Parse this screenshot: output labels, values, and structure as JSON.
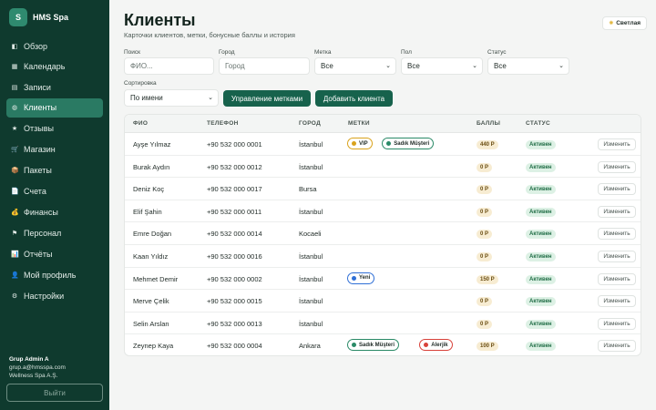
{
  "brand": {
    "logo_letter": "S",
    "name": "HMS Spa"
  },
  "sidebar": {
    "items": [
      {
        "label": "Обзор",
        "icon": "dashboard-icon",
        "glyph": "◧",
        "active": false
      },
      {
        "label": "Календарь",
        "icon": "calendar-icon",
        "glyph": "▦",
        "active": false
      },
      {
        "label": "Записи",
        "icon": "appointments-icon",
        "glyph": "▤",
        "active": false
      },
      {
        "label": "Клиенты",
        "icon": "clients-icon",
        "glyph": "◍",
        "active": true
      },
      {
        "label": "Отзывы",
        "icon": "star-icon",
        "glyph": "★",
        "active": false
      },
      {
        "label": "Магазин",
        "icon": "cart-icon",
        "glyph": "🛒",
        "active": false
      },
      {
        "label": "Пакеты",
        "icon": "package-icon",
        "glyph": "📦",
        "active": false
      },
      {
        "label": "Счета",
        "icon": "invoice-icon",
        "glyph": "📄",
        "active": false
      },
      {
        "label": "Финансы",
        "icon": "money-bag-icon",
        "glyph": "💰",
        "active": false
      },
      {
        "label": "Персонал",
        "icon": "flag-icon",
        "glyph": "⚑",
        "active": false
      },
      {
        "label": "Отчёты",
        "icon": "reports-icon",
        "glyph": "📊",
        "active": false
      },
      {
        "label": "Мой профиль",
        "icon": "profile-icon",
        "glyph": "👤",
        "active": false
      },
      {
        "label": "Настройки",
        "icon": "gear-icon",
        "glyph": "⚙",
        "active": false
      }
    ]
  },
  "user": {
    "name": "Grup Admin A",
    "email": "grup.a@hmsspa.com",
    "company": "Wellness Spa A.Ş.",
    "logout_label": "Выйти"
  },
  "header": {
    "title": "Клиенты",
    "subtitle": "Карточки клиентов, метки, бонусные баллы и история",
    "theme_label": "Светлая",
    "theme_icon": "sun-icon"
  },
  "filters": {
    "search_label": "Поиск",
    "search_placeholder": "ФИО...",
    "city_label": "Город",
    "city_placeholder": "Город",
    "tag_label": "Метка",
    "tag_value": "Все",
    "gender_label": "Пол",
    "gender_value": "Все",
    "status_label": "Статус",
    "status_value": "Все",
    "sort_label": "Сортировка",
    "sort_value": "По имени"
  },
  "actions": {
    "manage_tags": "Управление метками",
    "add_client": "Добавить клиента"
  },
  "table": {
    "columns": [
      "ФИО",
      "ТЕЛЕФОН",
      "ГОРОД",
      "МЕТКИ",
      "БАЛЛЫ",
      "СТАТУС"
    ],
    "edit_label": "Изменить",
    "tag_colors": {
      "VIP": "#d9a21b",
      "Sadık Müşteri": "#2a8a67",
      "Yeni": "#2f6fd6",
      "Alerjik": "#d8423a"
    },
    "rows": [
      {
        "name": "Ayşe Yılmaz",
        "phone": "+90 532 000 0001",
        "city": "İstanbul",
        "tags": [
          "VIP",
          "Sadık Müşteri"
        ],
        "points": "440 P",
        "status": "Активен"
      },
      {
        "name": "Burak Aydın",
        "phone": "+90 532 000 0012",
        "city": "İstanbul",
        "tags": [],
        "points": "0 P",
        "status": "Активен"
      },
      {
        "name": "Deniz Koç",
        "phone": "+90 532 000 0017",
        "city": "Bursa",
        "tags": [],
        "points": "0 P",
        "status": "Активен"
      },
      {
        "name": "Elif Şahin",
        "phone": "+90 532 000 0011",
        "city": "İstanbul",
        "tags": [],
        "points": "0 P",
        "status": "Активен"
      },
      {
        "name": "Emre Doğan",
        "phone": "+90 532 000 0014",
        "city": "Kocaeli",
        "tags": [],
        "points": "0 P",
        "status": "Активен"
      },
      {
        "name": "Kaan Yıldız",
        "phone": "+90 532 000 0016",
        "city": "İstanbul",
        "tags": [],
        "points": "0 P",
        "status": "Активен"
      },
      {
        "name": "Mehmet Demir",
        "phone": "+90 532 000 0002",
        "city": "İstanbul",
        "tags": [
          "Yeni"
        ],
        "points": "150 P",
        "status": "Активен"
      },
      {
        "name": "Merve Çelik",
        "phone": "+90 532 000 0015",
        "city": "İstanbul",
        "tags": [],
        "points": "0 P",
        "status": "Активен"
      },
      {
        "name": "Selin Arslan",
        "phone": "+90 532 000 0013",
        "city": "İstanbul",
        "tags": [],
        "points": "0 P",
        "status": "Активен"
      },
      {
        "name": "Zeynep Kaya",
        "phone": "+90 532 000 0004",
        "city": "Ankara",
        "tags": [
          "Sadık Müşteri",
          "Alerjik"
        ],
        "points": "100 P",
        "status": "Активен"
      }
    ]
  }
}
